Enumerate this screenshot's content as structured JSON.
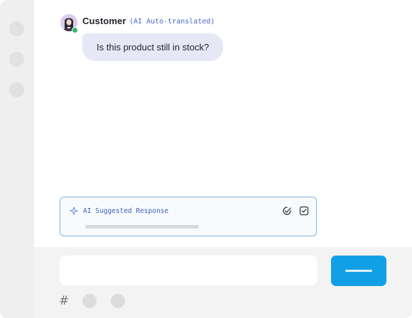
{
  "conversation": {
    "message": {
      "sender": "Customer",
      "translation_tag": "(AI Auto-translated)",
      "text": "Is this product still in stock?",
      "status": "online"
    }
  },
  "suggestion": {
    "label": "AI Suggested Response",
    "icons": [
      "sparkle-icon",
      "accept-suggestion-icon",
      "checkbox-icon"
    ]
  },
  "composer": {
    "input_value": "",
    "input_placeholder": "",
    "tools": [
      "hash-icon",
      "tool-button",
      "tool-button"
    ]
  },
  "sidebar": {
    "items": [
      "nav-item",
      "nav-item",
      "nav-item"
    ]
  },
  "colors": {
    "accent": "#11a0e6",
    "bubble": "#e6e9f5",
    "suggestion_border": "#7fb2e6",
    "translated_tag": "#4a67c9",
    "online": "#2fb96e"
  }
}
